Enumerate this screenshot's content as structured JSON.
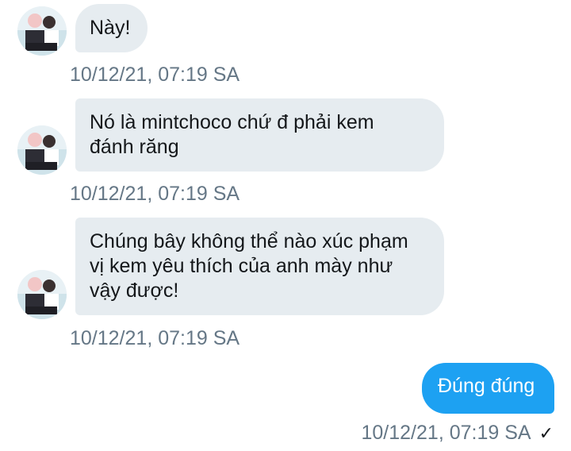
{
  "conversation": {
    "messages": [
      {
        "direction": "incoming",
        "lines": [
          "Này!"
        ],
        "timestamp": "10/12/21, 07:19 SA"
      },
      {
        "direction": "incoming",
        "lines": [
          "Nó là mintchoco chứ đ phải kem",
          "đánh răng"
        ],
        "timestamp": "10/12/21, 07:19 SA"
      },
      {
        "direction": "incoming",
        "lines": [
          "Chúng bây không thể nào xúc phạm",
          "vị kem yêu thích của anh mày như",
          "vậy được!"
        ],
        "timestamp": "10/12/21, 07:19 SA"
      },
      {
        "direction": "outgoing",
        "lines": [
          "Đúng đúng"
        ],
        "timestamp": "10/12/21, 07:19 SA",
        "status_icon": "checkmark-icon",
        "status_glyph": "✓"
      }
    ]
  },
  "colors": {
    "incoming_bubble": "#e6ecf0",
    "outgoing_bubble": "#1da1f2",
    "timestamp": "#657786"
  }
}
